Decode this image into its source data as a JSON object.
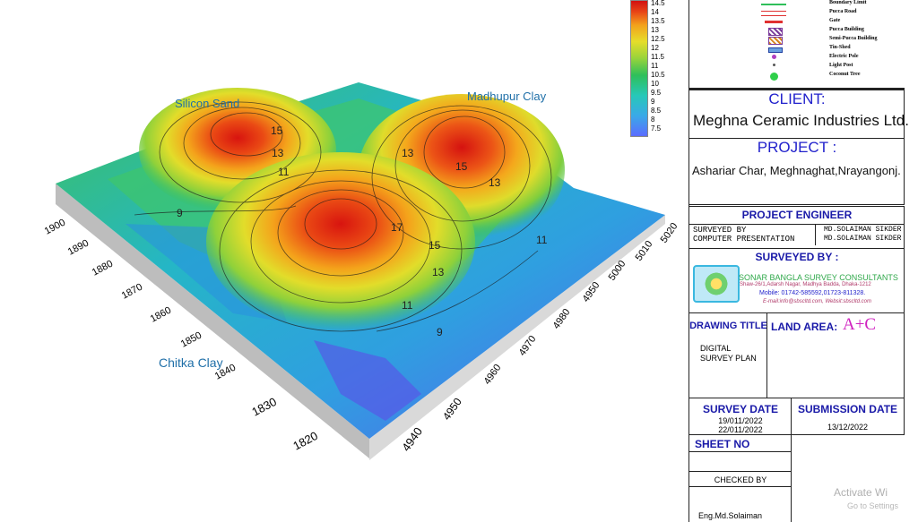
{
  "map": {
    "site_labels": {
      "silicon_sand": "Silicon Sand",
      "madhupur_clay": "Madhupur Clay",
      "chitka_clay": "Chitka Clay"
    },
    "y_axis_ticks": [
      "1900",
      "1890",
      "1880",
      "1870",
      "1860",
      "1850",
      "1840",
      "1830",
      "1820"
    ],
    "x_axis_ticks": [
      "4940",
      "4950",
      "4960",
      "4970",
      "4980",
      "4950",
      "5000",
      "5010",
      "5020"
    ],
    "contour_labels": [
      "15",
      "13",
      "11",
      "9",
      "17",
      "15",
      "13",
      "11",
      "9",
      "13",
      "15",
      "13",
      "11"
    ]
  },
  "color_scale": {
    "labels": [
      "14.5",
      "14",
      "13.5",
      "13",
      "12.5",
      "12",
      "11.5",
      "11",
      "10.5",
      "10",
      "9.5",
      "9",
      "8.5",
      "8",
      "7.5"
    ],
    "colors": [
      "#5b6cff",
      "#3aa9e8",
      "#27c8b8",
      "#2fbf5a",
      "#9bd43a",
      "#e6dd2a",
      "#f3a21c",
      "#e84416",
      "#d11010"
    ]
  },
  "legend": [
    {
      "label": "Boundary Limit",
      "icon": "green-line"
    },
    {
      "label": "Pucca Road",
      "icon": "red-double-line"
    },
    {
      "label": "Gate",
      "icon": "gate-icon"
    },
    {
      "label": "Pucca Building",
      "icon": "hatched-purple-box"
    },
    {
      "label": "Semi-Pucca Building",
      "icon": "hatched-orange-box"
    },
    {
      "label": "Tin-Shed",
      "icon": "blue-box"
    },
    {
      "label": "Electric Pole",
      "icon": "purple-dot"
    },
    {
      "label": "Light Post",
      "icon": "small-dot"
    },
    {
      "label": "Coconut Tree",
      "icon": "tree-icon"
    }
  ],
  "panel": {
    "client_heading": "CLIENT:",
    "client_name": "Meghna Ceramic Industries Ltd.",
    "project_heading": "PROJECT :",
    "project_name": "Ashariar Char, Meghnaghat,Nrayangonj.",
    "engineer_heading": "PROJECT ENGINEER",
    "surveyed_by_label": "SURVEYED BY",
    "surveyed_by_value": "MD.SOLAIMAN  SIKDER",
    "computer_label": "COMPUTER PRESENTATION",
    "computer_value": "MD.SOLAIMAN  SIKDER",
    "surveyed_by_heading": "SURVEYED BY :",
    "company_name": "SONAR BANGLA SURVEY CONSULTANTS",
    "company_address": "Shaw-26/1,Adarsh Nagar, Madhya Badda, Dhaka-1212",
    "company_mobile": "Mobile: 01742-585592,01723-811328.",
    "company_email": "E-mail:info@sbscltd.com, Websit:sbscltd.com",
    "drawing_title_heading": "DRAWING TITLE",
    "land_area_heading": "LAND AREA:",
    "land_area_value": "A+C",
    "drawing_title_line1": "DIGITAL",
    "drawing_title_line2": "SURVEY PLAN",
    "survey_date_heading": "SURVEY DATE",
    "survey_date_1": "19/011/2022",
    "survey_date_2": "22/011/2022",
    "submission_date_heading": "SUBMISSION DATE",
    "submission_date": "13/12/2022",
    "sheet_no_heading": "SHEET NO",
    "checked_by_heading": "CHECKED BY",
    "checked_by_value": "Eng.Md.Solaiman"
  },
  "watermark": {
    "line1": "Activate Wi",
    "line2": "Go to Settings"
  }
}
